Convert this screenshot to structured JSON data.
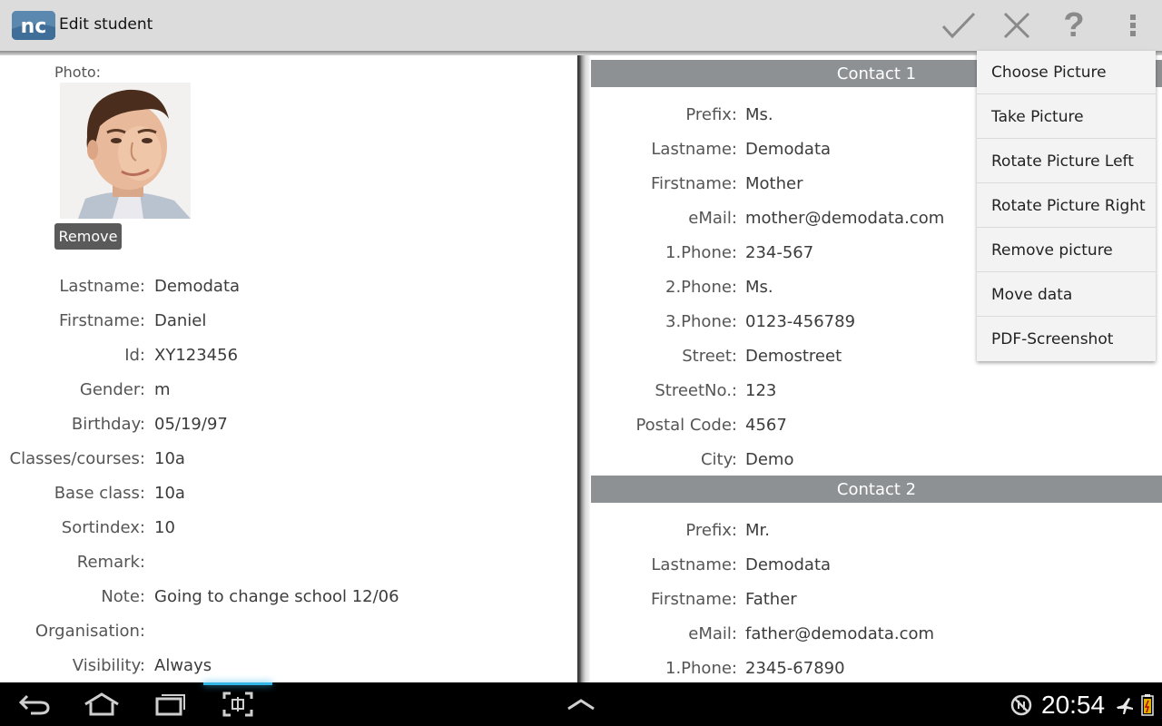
{
  "app": {
    "title": "Edit student",
    "logo_text": "nc"
  },
  "toolbar": {
    "icons": [
      "check-icon",
      "close-icon",
      "help-icon",
      "overflow-menu-icon"
    ],
    "help_glyph": "?"
  },
  "student": {
    "photo_label": "Photo:",
    "remove_label": "Remove",
    "fields": [
      {
        "label": "Lastname:",
        "value": "Demodata"
      },
      {
        "label": "Firstname:",
        "value": "Daniel"
      },
      {
        "label": "Id:",
        "value": "XY123456"
      },
      {
        "label": "Gender:",
        "value": "m"
      },
      {
        "label": "Birthday:",
        "value": "05/19/97"
      },
      {
        "label": "Classes/courses:",
        "value": "10a"
      },
      {
        "label": "Base class:",
        "value": "10a"
      },
      {
        "label": "Sortindex:",
        "value": "10"
      },
      {
        "label": "Remark:",
        "value": ""
      },
      {
        "label": "Note:",
        "value": "Going to change school 12/06"
      },
      {
        "label": "Organisation:",
        "value": ""
      },
      {
        "label": "Visibility:",
        "value": "Always"
      }
    ]
  },
  "contact1": {
    "title": "Contact 1",
    "fields": [
      {
        "label": "Prefix:",
        "value": "Ms."
      },
      {
        "label": "Lastname:",
        "value": "Demodata"
      },
      {
        "label": "Firstname:",
        "value": "Mother"
      },
      {
        "label": "eMail:",
        "value": "mother@demodata.com"
      },
      {
        "label": "1.Phone:",
        "value": "234-567"
      },
      {
        "label": "2.Phone:",
        "value": "Ms."
      },
      {
        "label": "3.Phone:",
        "value": "0123-456789"
      },
      {
        "label": "Street:",
        "value": "Demostreet"
      },
      {
        "label": "StreetNo.:",
        "value": "123"
      },
      {
        "label": "Postal Code:",
        "value": "4567"
      },
      {
        "label": "City:",
        "value": "Demo"
      }
    ]
  },
  "contact2": {
    "title": "Contact 2",
    "fields": [
      {
        "label": "Prefix:",
        "value": "Mr."
      },
      {
        "label": "Lastname:",
        "value": "Demodata"
      },
      {
        "label": "Firstname:",
        "value": "Father"
      },
      {
        "label": "eMail:",
        "value": "father@demodata.com"
      },
      {
        "label": "1.Phone:",
        "value": "2345-67890"
      }
    ]
  },
  "menu": {
    "items": [
      "Choose Picture",
      "Take Picture",
      "Rotate Picture Left",
      "Rotate Picture Right",
      "Remove picture",
      "Move data",
      "PDF-Screenshot"
    ]
  },
  "system_bar": {
    "clock": "20:54",
    "icons": [
      "back-icon",
      "home-icon",
      "recent-apps-icon",
      "screenshot-icon",
      "up-arrow-icon",
      "sync-icon",
      "airplane-icon",
      "battery-icon"
    ]
  },
  "colors": {
    "action_bar": "#dcdcdc",
    "section_header": "#8e9194",
    "system_bar": "#000000",
    "logo": "#4e7fa8",
    "battery": "#e0b000"
  }
}
